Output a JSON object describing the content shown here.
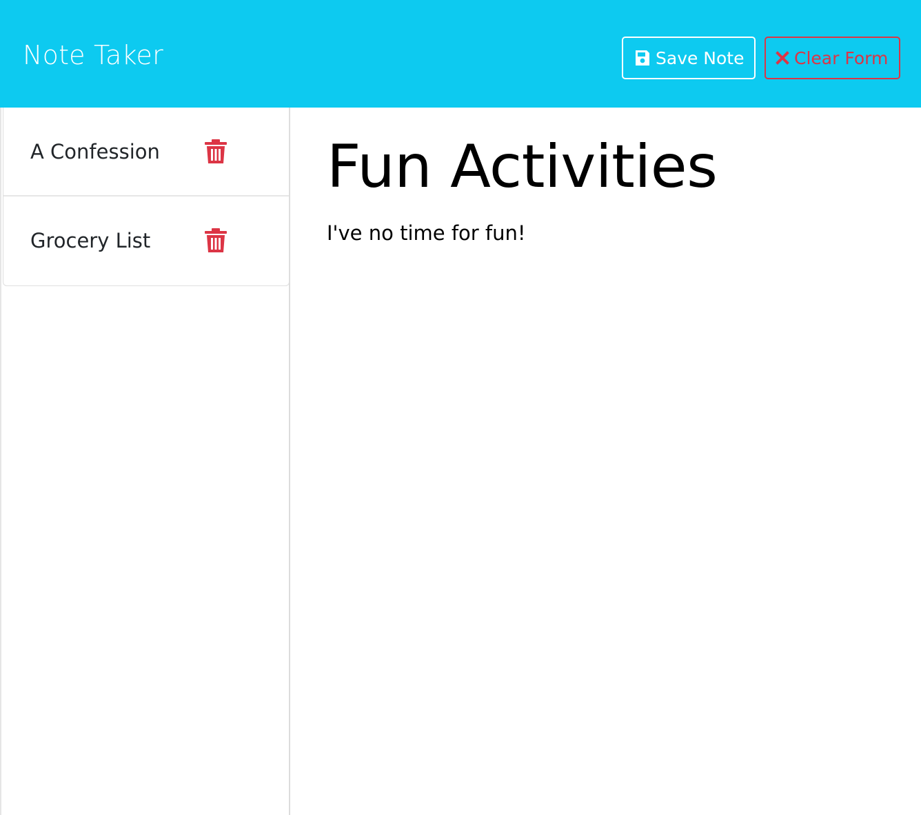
{
  "navbar": {
    "brand": "Note Taker",
    "background_color": "#0dcaf0",
    "save_label": "Save Note",
    "save_icon": "floppy-disk-icon",
    "clear_label": "Clear Form",
    "clear_icon": "x-mark-icon",
    "danger_color": "#dc3545"
  },
  "sidebar": {
    "items": [
      {
        "label": "A Confession",
        "icon": "trash-icon"
      },
      {
        "label": "Grocery List",
        "icon": "trash-icon"
      }
    ]
  },
  "main": {
    "title": "Fun Activities",
    "text": "I've no time for fun!"
  }
}
